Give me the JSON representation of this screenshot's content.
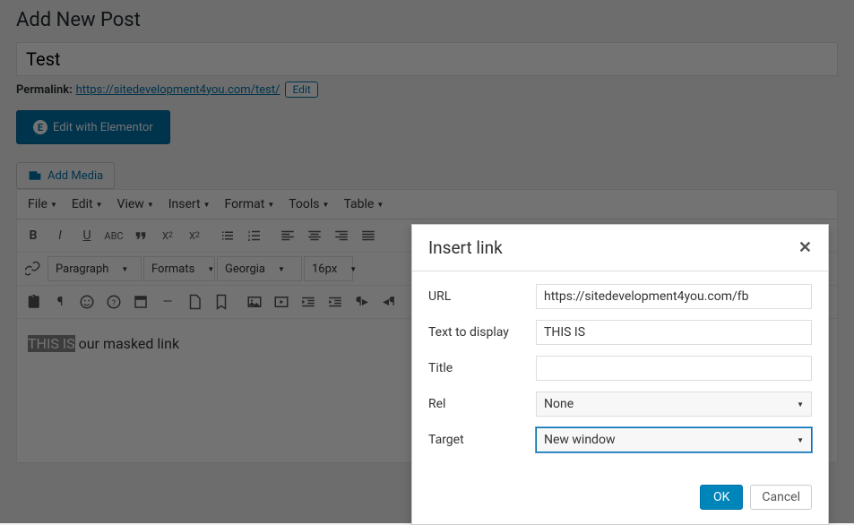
{
  "page": {
    "heading": "Add New Post",
    "title_value": "Test"
  },
  "permalink": {
    "label": "Permalink:",
    "url": "https://sitedevelopment4you.com/test/",
    "edit": "Edit"
  },
  "elementor": {
    "label": "Edit with Elementor"
  },
  "media": {
    "label": "Add Media"
  },
  "menubar": [
    "File",
    "Edit",
    "View",
    "Insert",
    "Format",
    "Tools",
    "Table"
  ],
  "toolbar2": {
    "paragraph": "Paragraph",
    "formats": "Formats",
    "font": "Georgia",
    "size": "16px"
  },
  "editor": {
    "selected": "THIS IS",
    "rest": " our masked link"
  },
  "modal": {
    "title": "Insert link",
    "labels": {
      "url": "URL",
      "text": "Text to display",
      "title": "Title",
      "rel": "Rel",
      "target": "Target"
    },
    "values": {
      "url": "https://sitedevelopment4you.com/fb",
      "text": "THIS IS",
      "title": "",
      "rel": "None",
      "target": "New window"
    },
    "ok": "OK",
    "cancel": "Cancel"
  }
}
